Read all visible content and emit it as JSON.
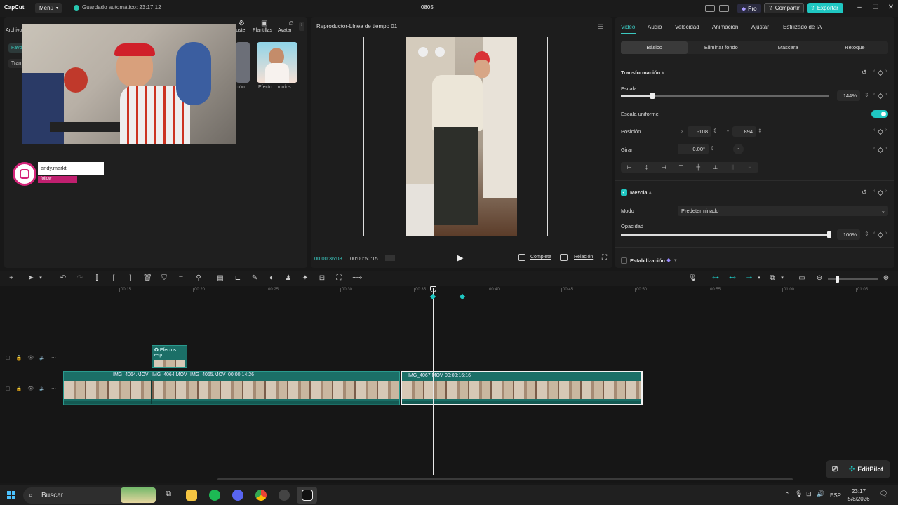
{
  "titlebar": {
    "logo": "CapCut",
    "menu": "Menú",
    "autosave": "Guardado automático: 23:17:12",
    "project": "0805",
    "pro": "Pro",
    "share": "Compartir",
    "export": "Exportar"
  },
  "left_panel": {
    "tabs": [
      {
        "label": "Archivo"
      },
      {
        "label": "Ajuste"
      },
      {
        "label": "Plantillas"
      },
      {
        "label": "Avatar"
      }
    ],
    "chips": [
      "Favo",
      "Tran"
    ],
    "thumb_labels": [
      "ción",
      "Efecto ...rcoíris"
    ],
    "instagram": {
      "handle": "andy.markt",
      "follow": "follow"
    }
  },
  "player": {
    "title": "Reproductor-Línea de tiempo 01",
    "time_current": "00:00:36:08",
    "time_total": "00:00:50:15",
    "btn_full": "Completa",
    "btn_ratio": "Relación"
  },
  "right_panel": {
    "tabs": [
      "Video",
      "Audio",
      "Velocidad",
      "Animación",
      "Ajustar",
      "Estilizado de IA"
    ],
    "subtabs": [
      "Básico",
      "Eliminar fondo",
      "Máscara",
      "Retoque"
    ],
    "transform_title": "Transformación",
    "scale_label": "Escala",
    "scale_value": "144%",
    "scale_level": 0.15,
    "uniform_label": "Escala uniforme",
    "position_label": "Posición",
    "pos_x_label": "X",
    "pos_x": "-108",
    "pos_y_label": "Y",
    "pos_y": "894",
    "rotate_label": "Girar",
    "rotate_value": "0.00°",
    "blend_title": "Mezcla",
    "mode_label": "Modo",
    "mode_value": "Predeterminado",
    "opacity_label": "Opacidad",
    "opacity_value": "100%",
    "opacity_level": 1.0,
    "stabilize_label": "Estabilización"
  },
  "timeline": {
    "ruler": [
      "00:15",
      "00:20",
      "00:25",
      "00:30",
      "00:35",
      "00:40",
      "00:45",
      "00:50",
      "00:55",
      "01:00",
      "01:05"
    ],
    "effect_clip": "Efectos esp",
    "clips": [
      {
        "name": "IMG_4064.MOV"
      },
      {
        "name": "IMG_4064.MOV"
      },
      {
        "name": "IMG_4065.MOV",
        "duration": "00:00:14:26"
      },
      {
        "name": "IMG_4067.MOV",
        "duration": "00:00:16:16"
      }
    ]
  },
  "editpilot": "EditPilot",
  "taskbar": {
    "search": "Buscar",
    "lang": "ESP",
    "time": "23:17",
    "date": "5/8/2026"
  },
  "colors": {
    "accent": "#1fc7c2",
    "clip": "#1b6f67"
  }
}
